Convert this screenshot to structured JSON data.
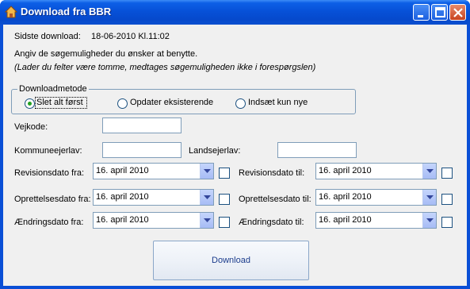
{
  "window": {
    "title": "Download fra BBR"
  },
  "header": {
    "last_download_label": "Sidste download:",
    "last_download_value": "18-06-2010 Kl.11:02",
    "instruction": "Angiv de søgemuligheder du ønsker at benytte.",
    "hint": "(Lader du felter være tomme, medtages søgemuligheden ikke i forespørgslen)"
  },
  "download_method": {
    "legend": "Downloadmetode",
    "options": [
      {
        "label": "Slet alt først",
        "selected": true
      },
      {
        "label": "Opdater eksisterende",
        "selected": false
      },
      {
        "label": "Indsæt kun nye",
        "selected": false
      }
    ]
  },
  "fields": {
    "vejkode_label": "Vejkode:",
    "vejkode_value": "",
    "kommuneejerlav_label": "Kommuneejerlav:",
    "kommuneejerlav_value": "",
    "landsejerlav_label": "Landsejerlav:",
    "landsejerlav_value": ""
  },
  "dates": {
    "revision_from_label": "Revisionsdato fra:",
    "revision_from_value": "16. april 2010",
    "revision_to_label": "Revisionsdato til:",
    "revision_to_value": "16. april 2010",
    "created_from_label": "Oprettelsesdato fra:",
    "created_from_value": "16. april 2010",
    "created_to_label": "Oprettelsesdato til:",
    "created_to_value": "16. april 2010",
    "changed_from_label": "Ændringsdato fra:",
    "changed_from_value": "16. april 2010",
    "changed_to_label": "Ændringsdato til:",
    "changed_to_value": "16. april 2010"
  },
  "actions": {
    "download_label": "Download"
  },
  "colors": {
    "titlebar": "#0751d8",
    "accent": "#21a121"
  }
}
